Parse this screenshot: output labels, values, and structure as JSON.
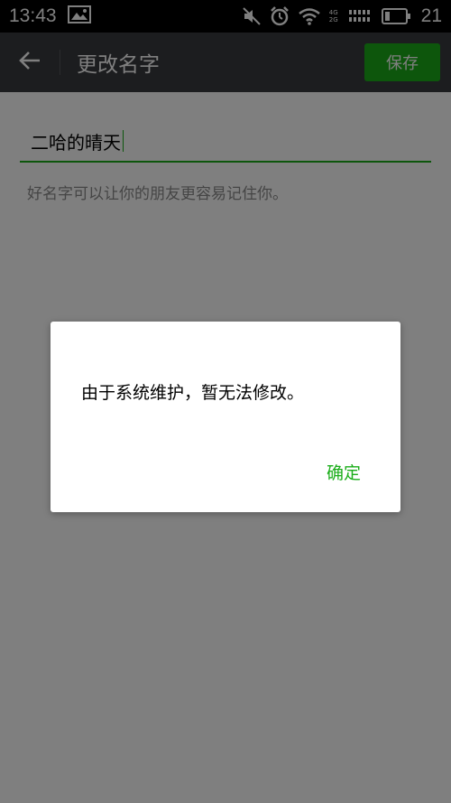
{
  "status_bar": {
    "time": "13:43",
    "network_labels": [
      "4G",
      "2G"
    ],
    "battery_level": "21",
    "icons": [
      "image-icon",
      "mute-icon",
      "alarm-icon",
      "wifi-icon",
      "signal-icon",
      "battery-icon"
    ]
  },
  "toolbar": {
    "back_icon": "arrow-left-icon",
    "title": "更改名字",
    "save_label": "保存"
  },
  "form": {
    "name_value": "二哈的晴天",
    "hint": "好名字可以让你的朋友更容易记住你。"
  },
  "dialog": {
    "message": "由于系统维护，暂无法修改。",
    "confirm_label": "确定"
  },
  "colors": {
    "accent": "#1aad19",
    "toolbar_bg": "#393a3f",
    "overlay": "rgba(0,0,0,0.5)"
  }
}
